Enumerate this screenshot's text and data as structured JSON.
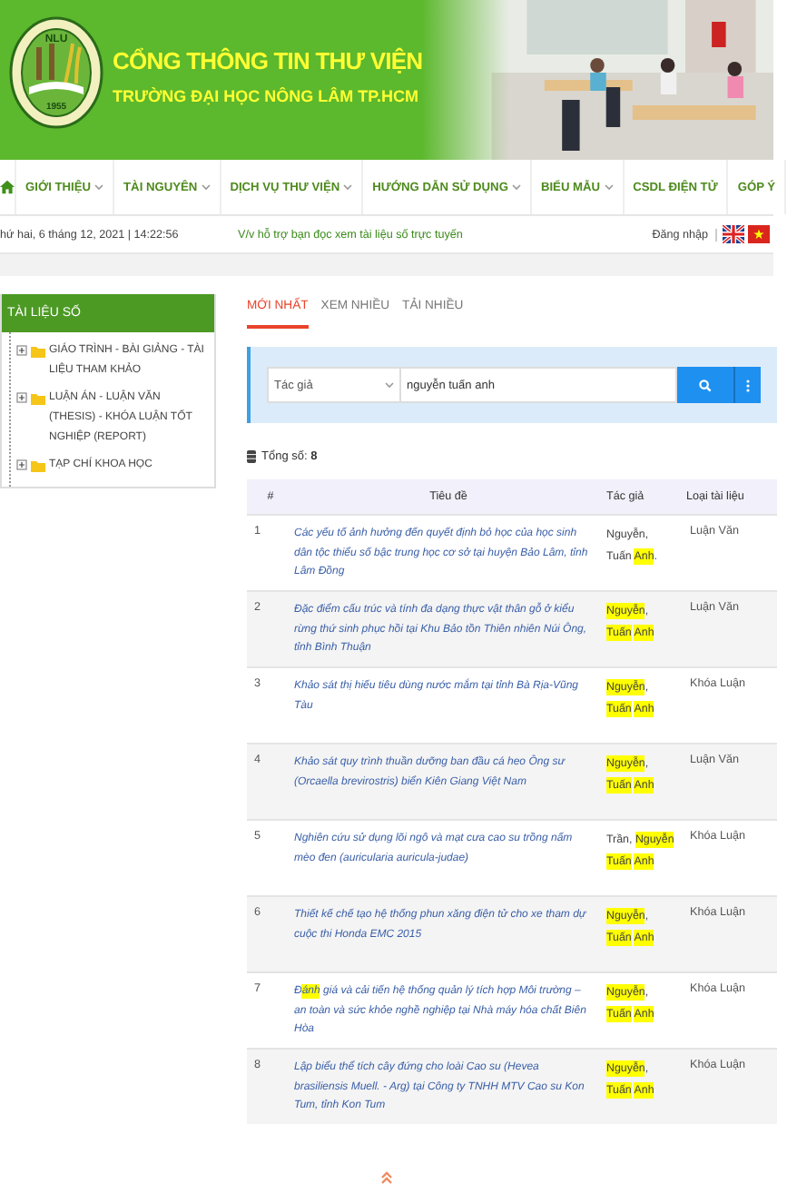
{
  "header": {
    "logo": {
      "top_text": "NLU",
      "year": "1955"
    },
    "title": "CỔNG THÔNG TIN THƯ VIỆN",
    "subtitle": "TRƯỜNG ĐẠI HỌC NÔNG LÂM TP.HCM"
  },
  "nav": {
    "items": [
      {
        "label": "GIỚI THIỆU",
        "dropdown": true
      },
      {
        "label": "TÀI NGUYÊN",
        "dropdown": true
      },
      {
        "label": "DỊCH VỤ THƯ VIỆN",
        "dropdown": true
      },
      {
        "label": "HƯỚNG DẪN SỬ DỤNG",
        "dropdown": true
      },
      {
        "label": "BIỂU MẪU",
        "dropdown": true
      },
      {
        "label": "CSDL ĐIỆN TỬ",
        "dropdown": false
      },
      {
        "label": "GÓP Ý",
        "dropdown": false
      }
    ]
  },
  "info_bar": {
    "date": "hứ hai, 6 tháng 12, 2021 | 14:22:56",
    "notice": "V/v hỗ trợ bạn đọc xem tài liệu số trực tuyến",
    "login": "Đăng nhập",
    "languages": [
      {
        "kind": "uk"
      },
      {
        "kind": "vn"
      }
    ]
  },
  "sidebar": {
    "title": "TÀI LIỆU SỐ",
    "items": [
      {
        "label": "GIÁO TRÌNH - BÀI GIẢNG - TÀI LIỆU THAM KHẢO",
        "expanded": false
      },
      {
        "label": "LUẬN ÁN - LUẬN VĂN (THESIS) - KHÓA LUẬN TỐT NGHIỆP (REPORT)",
        "expanded": false
      },
      {
        "label": "TẠP CHÍ KHOA HỌC",
        "expanded": false
      }
    ]
  },
  "tabs": [
    {
      "label": "MỚI NHẤT",
      "selected": true
    },
    {
      "label": "XEM NHIỀU",
      "selected": false
    },
    {
      "label": "TẢI NHIỀU",
      "selected": false
    }
  ],
  "search": {
    "field_select": "Tác giả",
    "value": "nguyễn tuấn anh"
  },
  "total": "Tổng số: **8**",
  "table": {
    "columns": [
      "#",
      "Tiêu đề",
      "Tác giả",
      "Loại tài liệu"
    ],
    "rows": [
      {
        "number": "1",
        "title": [
          {
            "text": "Các yếu tố ảnh hưởng đến quyết định bỏ học của học sinh dân tộc thiểu số bậc trung học cơ sở tại huyện Bảo Lâm, tỉnh Lâm Đồng",
            "highlighted": false
          }
        ],
        "author": [
          {
            "text": "Nguyễn, Tuấn ",
            "highlighted": false
          },
          {
            "text": "Anh",
            "highlighted": true
          },
          {
            "text": ".",
            "highlighted": false
          }
        ],
        "type": "Luận Văn"
      },
      {
        "number": "2",
        "title": [
          {
            "text": "Đặc điểm cấu trúc và tính đa dạng thực vật thân gỗ ở kiểu rừng thứ sinh phục hồi tại Khu Bảo tồn Thiên nhiên Núi Ông, tỉnh Bình Thuận",
            "highlighted": false
          }
        ],
        "author": [
          {
            "text": "Nguyễn",
            "highlighted": true
          },
          {
            "text": ", ",
            "highlighted": false
          },
          {
            "text": "Tuấn",
            "highlighted": true
          },
          {
            "text": "Anh",
            "highlighted": true
          }
        ],
        "type": "Luận Văn"
      },
      {
        "number": "3",
        "title": [
          {
            "text": "Khảo sát thị hiếu tiêu dùng nước mắm tại tỉnh Bà Rịa-Vũng Tàu",
            "highlighted": false
          }
        ],
        "author": [
          {
            "text": "Nguyễn",
            "highlighted": true
          },
          {
            "text": ", ",
            "highlighted": false
          },
          {
            "text": "Tuấn",
            "highlighted": true
          },
          {
            "text": "Anh",
            "highlighted": true
          }
        ],
        "type": "Khóa Luận"
      },
      {
        "number": "4",
        "title": [
          {
            "text": "Khảo sát quy trình thuần dưỡng ban đầu cá heo Ông sư (Orcaella brevirostris) biển Kiên Giang Việt Nam",
            "highlighted": false
          }
        ],
        "author": [
          {
            "text": "Nguyễn",
            "highlighted": true
          },
          {
            "text": ", ",
            "highlighted": false
          },
          {
            "text": "Tuấn",
            "highlighted": true
          },
          {
            "text": "Anh",
            "highlighted": true
          }
        ],
        "type": "Luận Văn"
      },
      {
        "number": "5",
        "title": [
          {
            "text": "Nghiên cứu sử dụng lõi ngô và mạt cưa cao su trồng nấm mèo đen (auricularia auricula-judae)",
            "highlighted": false
          }
        ],
        "author": [
          {
            "text": "Trần, ",
            "highlighted": false
          },
          {
            "text": "Nguyễn",
            "highlighted": true
          },
          {
            "text": "Tuấn",
            "highlighted": true
          },
          {
            "text": "Anh",
            "highlighted": true
          }
        ],
        "type": "Khóa Luận"
      },
      {
        "number": "6",
        "title": [
          {
            "text": "Thiết kế chế tạo hệ thống phun xăng điện tử cho xe tham dự cuộc thi Honda EMC 2015",
            "highlighted": false
          }
        ],
        "author": [
          {
            "text": "Nguyễn",
            "highlighted": true
          },
          {
            "text": ", ",
            "highlighted": false
          },
          {
            "text": "Tuấn",
            "highlighted": true
          },
          {
            "text": "Anh",
            "highlighted": true
          }
        ],
        "type": "Khóa Luận"
      },
      {
        "number": "7",
        "title": [
          {
            "text": "Đ",
            "highlighted": false
          },
          {
            "text": "ánh",
            "highlighted": true
          },
          {
            "text": " giá và cải tiến hệ thống quản lý tích hợp Môi trường – an toàn và sức khỏe nghề nghiệp tại Nhà máy hóa chất Biên Hòa",
            "highlighted": false
          }
        ],
        "author": [
          {
            "text": "Nguyễn",
            "highlighted": true
          },
          {
            "text": ", ",
            "highlighted": false
          },
          {
            "text": "Tuấn",
            "highlighted": true
          },
          {
            "text": "Anh",
            "highlighted": true
          }
        ],
        "type": "Khóa Luận"
      },
      {
        "number": "8",
        "title": [
          {
            "text": "Lập biểu thể tích cây đứng cho loài Cao su (Hevea brasiliensis Muell. - Arg) tại Công ty TNHH MTV Cao su Kon Tum, tỉnh Kon Tum",
            "highlighted": false
          }
        ],
        "author": [
          {
            "text": "Nguyễn",
            "highlighted": true
          },
          {
            "text": ", ",
            "highlighted": false
          },
          {
            "text": "Tuấn",
            "highlighted": true
          },
          {
            "text": "Anh",
            "highlighted": true
          }
        ],
        "type": "Khóa Luận"
      }
    ]
  }
}
